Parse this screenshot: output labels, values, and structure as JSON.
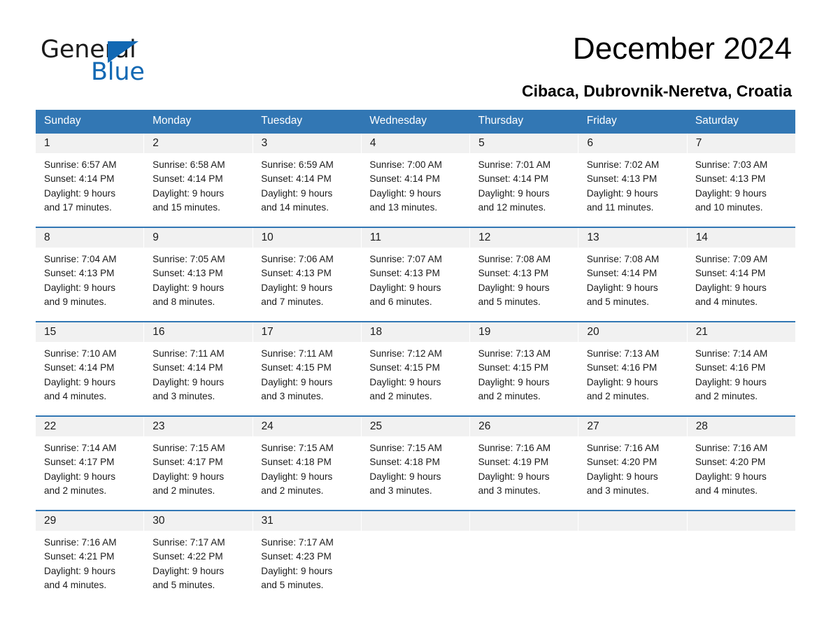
{
  "brand": {
    "name_part1": "General",
    "name_part2": "Blue",
    "accent_color": "#1268b3"
  },
  "header": {
    "title": "December 2024",
    "subtitle": "Cibaca, Dubrovnik-Neretva, Croatia"
  },
  "theme": {
    "header_blue": "#3277b4",
    "date_band_gray": "#f1f1f1",
    "text_color": "#1b1b1b"
  },
  "calendar": {
    "weekday_headers": [
      "Sunday",
      "Monday",
      "Tuesday",
      "Wednesday",
      "Thursday",
      "Friday",
      "Saturday"
    ],
    "weeks": [
      {
        "numbers": [
          "1",
          "2",
          "3",
          "4",
          "5",
          "6",
          "7"
        ],
        "cells": [
          {
            "sunrise": "Sunrise: 6:57 AM",
            "sunset": "Sunset: 4:14 PM",
            "daylight1": "Daylight: 9 hours",
            "daylight2": "and 17 minutes."
          },
          {
            "sunrise": "Sunrise: 6:58 AM",
            "sunset": "Sunset: 4:14 PM",
            "daylight1": "Daylight: 9 hours",
            "daylight2": "and 15 minutes."
          },
          {
            "sunrise": "Sunrise: 6:59 AM",
            "sunset": "Sunset: 4:14 PM",
            "daylight1": "Daylight: 9 hours",
            "daylight2": "and 14 minutes."
          },
          {
            "sunrise": "Sunrise: 7:00 AM",
            "sunset": "Sunset: 4:14 PM",
            "daylight1": "Daylight: 9 hours",
            "daylight2": "and 13 minutes."
          },
          {
            "sunrise": "Sunrise: 7:01 AM",
            "sunset": "Sunset: 4:14 PM",
            "daylight1": "Daylight: 9 hours",
            "daylight2": "and 12 minutes."
          },
          {
            "sunrise": "Sunrise: 7:02 AM",
            "sunset": "Sunset: 4:13 PM",
            "daylight1": "Daylight: 9 hours",
            "daylight2": "and 11 minutes."
          },
          {
            "sunrise": "Sunrise: 7:03 AM",
            "sunset": "Sunset: 4:13 PM",
            "daylight1": "Daylight: 9 hours",
            "daylight2": "and 10 minutes."
          }
        ]
      },
      {
        "numbers": [
          "8",
          "9",
          "10",
          "11",
          "12",
          "13",
          "14"
        ],
        "cells": [
          {
            "sunrise": "Sunrise: 7:04 AM",
            "sunset": "Sunset: 4:13 PM",
            "daylight1": "Daylight: 9 hours",
            "daylight2": "and 9 minutes."
          },
          {
            "sunrise": "Sunrise: 7:05 AM",
            "sunset": "Sunset: 4:13 PM",
            "daylight1": "Daylight: 9 hours",
            "daylight2": "and 8 minutes."
          },
          {
            "sunrise": "Sunrise: 7:06 AM",
            "sunset": "Sunset: 4:13 PM",
            "daylight1": "Daylight: 9 hours",
            "daylight2": "and 7 minutes."
          },
          {
            "sunrise": "Sunrise: 7:07 AM",
            "sunset": "Sunset: 4:13 PM",
            "daylight1": "Daylight: 9 hours",
            "daylight2": "and 6 minutes."
          },
          {
            "sunrise": "Sunrise: 7:08 AM",
            "sunset": "Sunset: 4:13 PM",
            "daylight1": "Daylight: 9 hours",
            "daylight2": "and 5 minutes."
          },
          {
            "sunrise": "Sunrise: 7:08 AM",
            "sunset": "Sunset: 4:14 PM",
            "daylight1": "Daylight: 9 hours",
            "daylight2": "and 5 minutes."
          },
          {
            "sunrise": "Sunrise: 7:09 AM",
            "sunset": "Sunset: 4:14 PM",
            "daylight1": "Daylight: 9 hours",
            "daylight2": "and 4 minutes."
          }
        ]
      },
      {
        "numbers": [
          "15",
          "16",
          "17",
          "18",
          "19",
          "20",
          "21"
        ],
        "cells": [
          {
            "sunrise": "Sunrise: 7:10 AM",
            "sunset": "Sunset: 4:14 PM",
            "daylight1": "Daylight: 9 hours",
            "daylight2": "and 4 minutes."
          },
          {
            "sunrise": "Sunrise: 7:11 AM",
            "sunset": "Sunset: 4:14 PM",
            "daylight1": "Daylight: 9 hours",
            "daylight2": "and 3 minutes."
          },
          {
            "sunrise": "Sunrise: 7:11 AM",
            "sunset": "Sunset: 4:15 PM",
            "daylight1": "Daylight: 9 hours",
            "daylight2": "and 3 minutes."
          },
          {
            "sunrise": "Sunrise: 7:12 AM",
            "sunset": "Sunset: 4:15 PM",
            "daylight1": "Daylight: 9 hours",
            "daylight2": "and 2 minutes."
          },
          {
            "sunrise": "Sunrise: 7:13 AM",
            "sunset": "Sunset: 4:15 PM",
            "daylight1": "Daylight: 9 hours",
            "daylight2": "and 2 minutes."
          },
          {
            "sunrise": "Sunrise: 7:13 AM",
            "sunset": "Sunset: 4:16 PM",
            "daylight1": "Daylight: 9 hours",
            "daylight2": "and 2 minutes."
          },
          {
            "sunrise": "Sunrise: 7:14 AM",
            "sunset": "Sunset: 4:16 PM",
            "daylight1": "Daylight: 9 hours",
            "daylight2": "and 2 minutes."
          }
        ]
      },
      {
        "numbers": [
          "22",
          "23",
          "24",
          "25",
          "26",
          "27",
          "28"
        ],
        "cells": [
          {
            "sunrise": "Sunrise: 7:14 AM",
            "sunset": "Sunset: 4:17 PM",
            "daylight1": "Daylight: 9 hours",
            "daylight2": "and 2 minutes."
          },
          {
            "sunrise": "Sunrise: 7:15 AM",
            "sunset": "Sunset: 4:17 PM",
            "daylight1": "Daylight: 9 hours",
            "daylight2": "and 2 minutes."
          },
          {
            "sunrise": "Sunrise: 7:15 AM",
            "sunset": "Sunset: 4:18 PM",
            "daylight1": "Daylight: 9 hours",
            "daylight2": "and 2 minutes."
          },
          {
            "sunrise": "Sunrise: 7:15 AM",
            "sunset": "Sunset: 4:18 PM",
            "daylight1": "Daylight: 9 hours",
            "daylight2": "and 3 minutes."
          },
          {
            "sunrise": "Sunrise: 7:16 AM",
            "sunset": "Sunset: 4:19 PM",
            "daylight1": "Daylight: 9 hours",
            "daylight2": "and 3 minutes."
          },
          {
            "sunrise": "Sunrise: 7:16 AM",
            "sunset": "Sunset: 4:20 PM",
            "daylight1": "Daylight: 9 hours",
            "daylight2": "and 3 minutes."
          },
          {
            "sunrise": "Sunrise: 7:16 AM",
            "sunset": "Sunset: 4:20 PM",
            "daylight1": "Daylight: 9 hours",
            "daylight2": "and 4 minutes."
          }
        ]
      },
      {
        "numbers": [
          "29",
          "30",
          "31",
          "",
          "",
          "",
          ""
        ],
        "cells": [
          {
            "sunrise": "Sunrise: 7:16 AM",
            "sunset": "Sunset: 4:21 PM",
            "daylight1": "Daylight: 9 hours",
            "daylight2": "and 4 minutes."
          },
          {
            "sunrise": "Sunrise: 7:17 AM",
            "sunset": "Sunset: 4:22 PM",
            "daylight1": "Daylight: 9 hours",
            "daylight2": "and 5 minutes."
          },
          {
            "sunrise": "Sunrise: 7:17 AM",
            "sunset": "Sunset: 4:23 PM",
            "daylight1": "Daylight: 9 hours",
            "daylight2": "and 5 minutes."
          },
          {
            "sunrise": "",
            "sunset": "",
            "daylight1": "",
            "daylight2": ""
          },
          {
            "sunrise": "",
            "sunset": "",
            "daylight1": "",
            "daylight2": ""
          },
          {
            "sunrise": "",
            "sunset": "",
            "daylight1": "",
            "daylight2": ""
          },
          {
            "sunrise": "",
            "sunset": "",
            "daylight1": "",
            "daylight2": ""
          }
        ]
      }
    ]
  }
}
